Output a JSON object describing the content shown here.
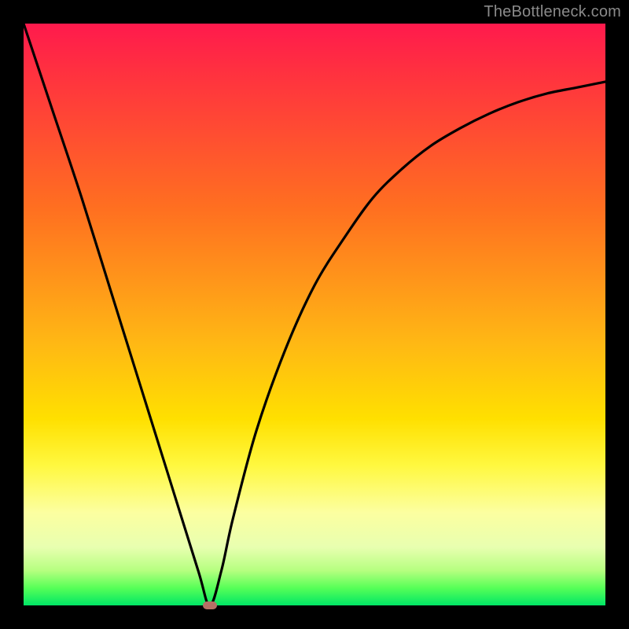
{
  "watermark": "TheBottleneck.com",
  "chart_data": {
    "type": "line",
    "title": "",
    "xlabel": "",
    "ylabel": "",
    "xlim": [
      0,
      100
    ],
    "ylim": [
      0,
      100
    ],
    "grid": false,
    "legend": false,
    "gradient_colors": {
      "top": "#ff1a4d",
      "mid_upper": "#ff951a",
      "mid_lower": "#ffe000",
      "bottom": "#00e666"
    },
    "series": [
      {
        "name": "bottleneck-curve",
        "x": [
          0,
          5,
          10,
          15,
          20,
          25,
          30,
          32,
          34,
          36,
          40,
          45,
          50,
          55,
          60,
          65,
          70,
          75,
          80,
          85,
          90,
          95,
          100
        ],
        "y": [
          100,
          85,
          70,
          54,
          38,
          22,
          6,
          0,
          6,
          15,
          30,
          44,
          55,
          63,
          70,
          75,
          79,
          82,
          84.5,
          86.5,
          88,
          89,
          90
        ]
      }
    ],
    "marker": {
      "x": 32,
      "y": 0,
      "color": "#b57065"
    }
  }
}
